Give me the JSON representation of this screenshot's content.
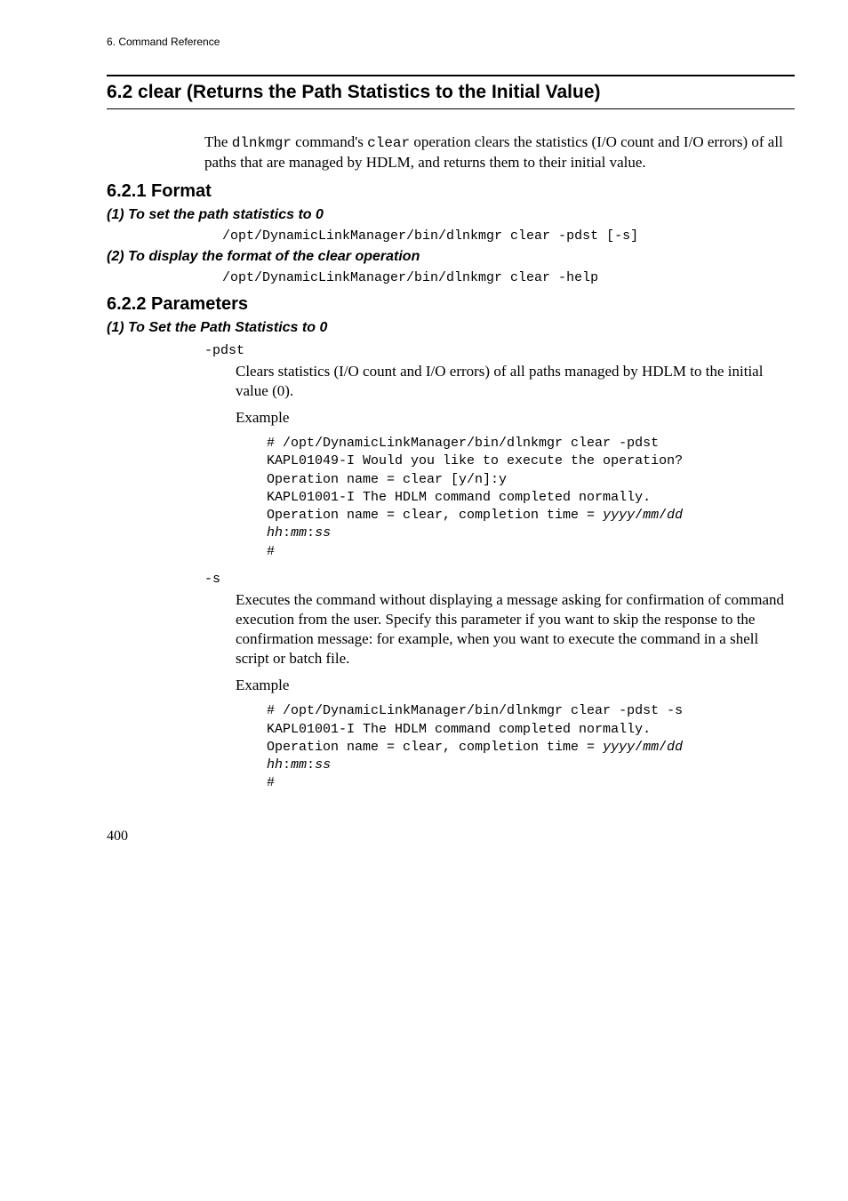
{
  "running_header": "6.  Command Reference",
  "section_title": "6.2  clear (Returns the Path Statistics to the Initial Value)",
  "intro_part1": "The ",
  "intro_mono1": "dlnkmgr",
  "intro_part2": " command's ",
  "intro_mono2": "clear",
  "intro_part3": " operation clears the statistics (I/O count and I/O errors) of all paths that are managed by HDLM, and returns them to their initial value.",
  "format_heading": "6.2.1  Format",
  "format_sub1": "(1)  To set the path statistics to 0",
  "format_code1": "/opt/DynamicLinkManager/bin/dlnkmgr clear -pdst [-s]",
  "format_sub2": "(2)  To display the format of the clear operation",
  "format_code2": "/opt/DynamicLinkManager/bin/dlnkmgr clear -help",
  "params_heading": "6.2.2  Parameters",
  "params_sub1": "(1)  To Set the Path Statistics to 0",
  "pdst": {
    "name": "-pdst",
    "desc": "Clears statistics (I/O count and I/O errors) of all paths managed by HDLM to the initial value (0).",
    "example_label": "Example",
    "ex_l1": "# /opt/DynamicLinkManager/bin/dlnkmgr clear -pdst",
    "ex_l2": "KAPL01049-I Would you like to execute the operation?",
    "ex_l3": "Operation name = clear [y/n]:y",
    "ex_l4": "KAPL01001-I The HDLM command completed normally.",
    "ex_l5a": "Operation name = clear, completion time = ",
    "ex_l5b_y": "yyyy",
    "ex_l5b_slash": "/",
    "ex_l5b_m": "mm",
    "ex_l5b_d": "dd",
    "ex_l6_hh": "hh",
    "ex_l6_colon": ":",
    "ex_l6_mm": "mm",
    "ex_l6_ss": "ss",
    "ex_l7": "#"
  },
  "s": {
    "name": "-s",
    "desc": "Executes the command without displaying a message asking for confirmation of command execution from the user. Specify this parameter if you want to skip the response to the confirmation message: for example, when you want to execute the command in a shell script or batch file.",
    "example_label": "Example",
    "ex_l1": "# /opt/DynamicLinkManager/bin/dlnkmgr clear -pdst -s",
    "ex_l2": "KAPL01001-I The HDLM command completed normally.",
    "ex_l3a": "Operation name = clear, completion time = ",
    "ex_l3b_y": "yyyy",
    "ex_l3b_slash": "/",
    "ex_l3b_m": "mm",
    "ex_l3b_d": "dd",
    "ex_l4_hh": "hh",
    "ex_l4_colon": ":",
    "ex_l4_mm": "mm",
    "ex_l4_ss": "ss",
    "ex_l5": "#"
  },
  "page_number": "400"
}
